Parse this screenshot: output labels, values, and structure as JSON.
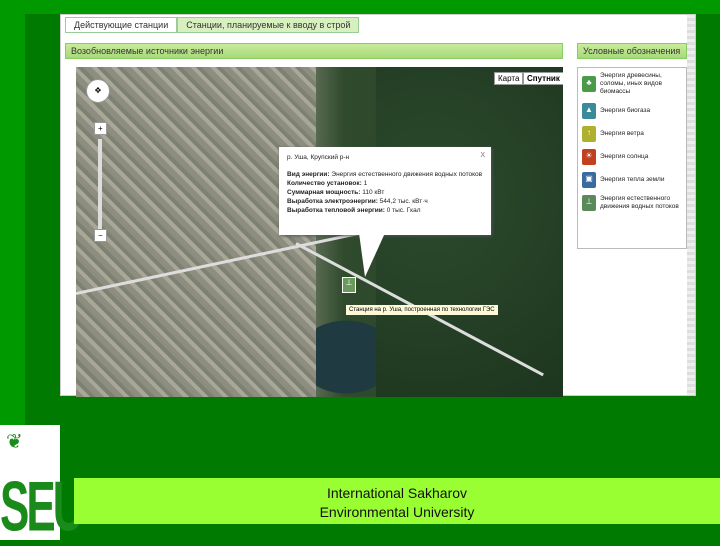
{
  "tabs": [
    "Действующие станции",
    "Станции, планируемые к вводу в строй"
  ],
  "panel_title": "Возобновляемые источники энергии",
  "legend_title": "Условные обозначения",
  "map_types": [
    "Карта",
    "Спутник"
  ],
  "legend": [
    {
      "label": "Энергия древесины, соломы, иных видов биомассы",
      "icon": "biomass-icon",
      "color": "#4a9a4a"
    },
    {
      "label": "Энергия биогаза",
      "icon": "biogas-icon",
      "color": "#3a8a9a"
    },
    {
      "label": "Энергия ветра",
      "icon": "wind-icon",
      "color": "#b0b030"
    },
    {
      "label": "Энергия солнца",
      "icon": "sun-icon",
      "color": "#c04020"
    },
    {
      "label": "Энергия тепла земли",
      "icon": "geothermal-icon",
      "color": "#3a6aa0"
    },
    {
      "label": "Энергия естественного движения водных потоков",
      "icon": "hydro-icon",
      "color": "#5a8a5a"
    }
  ],
  "popup": {
    "location": "р. Уша, Крупский р-н",
    "rows": [
      {
        "k": "Вид энергии:",
        "v": "Энергия естественного движения водных потоков"
      },
      {
        "k": "Количество установок:",
        "v": "1"
      },
      {
        "k": "Суммарная мощность:",
        "v": "110 кВт"
      },
      {
        "k": "Выработка электроэнергии:",
        "v": "544,2 тыс. кВт·ч"
      },
      {
        "k": "Выработка тепловой энергии:",
        "v": "0 тыс. Гкал"
      }
    ],
    "close": "x"
  },
  "marker_label": "Станция на р. Уша, построенная по технологии ГЭС",
  "logo_text": "SEU",
  "footer": [
    "International Sakharov",
    "Environmental University"
  ]
}
